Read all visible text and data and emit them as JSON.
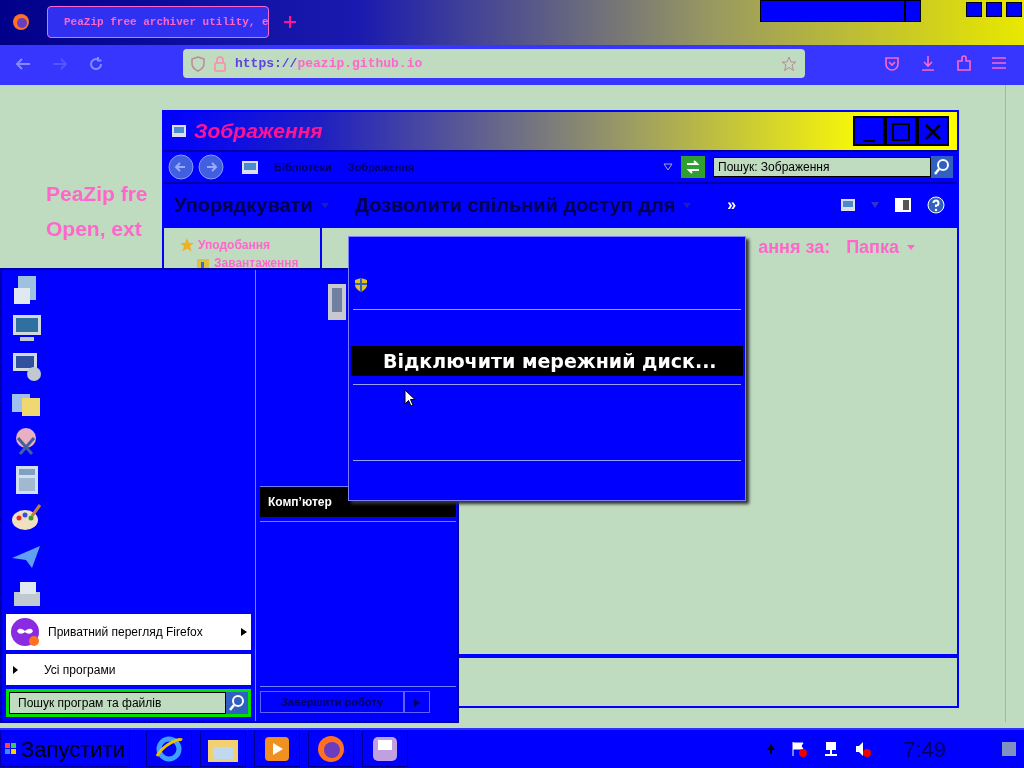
{
  "browser": {
    "tab": {
      "title": "PeaZip free archiver utility, e",
      "selected": true
    },
    "url": {
      "scheme": "https://",
      "host": "peazip.github.io"
    },
    "page_heading": [
      "PeaZip fre",
      "Open, ext"
    ]
  },
  "explorer": {
    "title": "Зображення",
    "breadcrumb": [
      "Бібліотеки",
      "Зображення"
    ],
    "search": {
      "placeholder": "Пошук: Зображення"
    },
    "toolbar": [
      "Упорядкувати",
      "Дозволити спільний доступ для"
    ],
    "more": "»",
    "nav_items": [
      "Уподобання",
      "Завантаження"
    ],
    "arrange_label": "ання за:",
    "arrange_value": "Папка"
  },
  "start_menu": {
    "recent": [
      {
        "label": "Приватний перегляд Firefox",
        "has_submenu": true
      }
    ],
    "all_programs": "Усі програми",
    "search": {
      "placeholder": "Пошук програм та файлів"
    },
    "places": [
      {
        "label": "Комп’ютер",
        "selected": true
      }
    ],
    "shutdown": "Завершити роботу"
  },
  "context_menu": {
    "items": [
      {
        "label": "Відключити мережний диск...",
        "selected": true
      }
    ]
  },
  "taskbar": {
    "start": "Запустити",
    "clock": "7:49"
  }
}
